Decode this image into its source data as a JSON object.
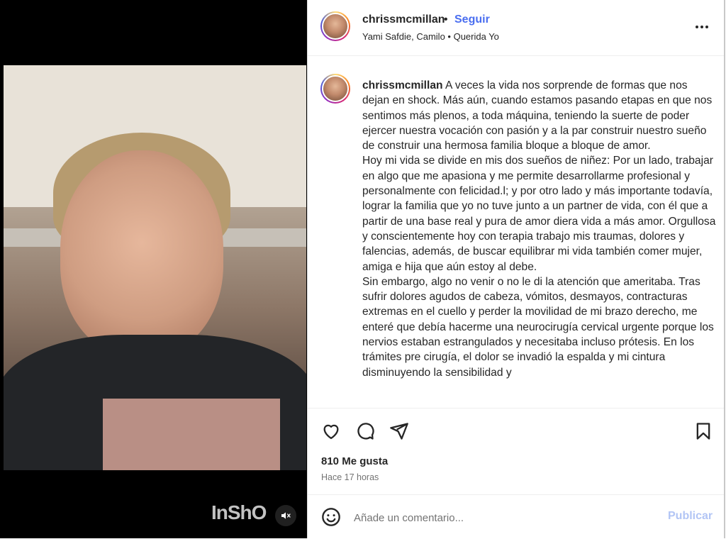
{
  "colors": {
    "follow_blue": "#4a6ef0",
    "publish_disabled": "#b2c5f5",
    "text_primary": "#262626",
    "text_secondary": "#737373"
  },
  "media": {
    "watermark": "InShO",
    "mute_icon": "speaker-muted-icon"
  },
  "header": {
    "username": "chrissmcmillan",
    "separator": "•",
    "follow_label": "Seguir",
    "audio_text": "Yami Safdie, Camilo • Querida Yo",
    "more_icon": "more-horizontal-icon"
  },
  "caption": {
    "username": "chrissmcmillan",
    "text": " A veces la vida nos sorprende de formas que nos dejan en shock. Más aún, cuando estamos pasando etapas en que nos sentimos más plenos, a toda máquina, teniendo la suerte de poder ejercer nuestra vocación con pasión y a la par construir nuestro sueño de construir una hermosa familia bloque a bloque de amor.\nHoy mi vida se divide en mis dos sueños de niñez: Por un lado, trabajar en algo que me apasiona y me permite desarrollarme profesional y personalmente con felicidad.l; y por otro lado y más importante todavía, lograr la familia que yo no tuve junto a un partner de vida, con él que a partir de una base real y pura de amor diera vida a más amor. Orgullosa y conscientemente hoy con terapia trabajo mis traumas, dolores y falencias, además, de buscar equilibrar mi vida también comer mujer, amiga e hija que aún estoy al debe.\nSin embargo, algo no venir o no le di la atención que ameritaba. Tras sufrir dolores agudos de cabeza, vómitos, desmayos, contracturas extremas en el cuello y perder la movilidad de mi brazo derecho, me enteré que debía hacerme una neurocirugía cervical urgente porque los nervios estaban estrangulados y necesitaba incluso prótesis. En los trámites pre cirugía, el dolor se invadió la espalda y mi cintura disminuyendo la sensibilidad y"
  },
  "actions": {
    "like_icon": "heart-icon",
    "comment_icon": "comment-icon",
    "share_icon": "share-icon",
    "save_icon": "bookmark-icon",
    "likes_text": "810 Me gusta",
    "time_text": "Hace 17 horas"
  },
  "comment_box": {
    "emoji_icon": "emoji-icon",
    "placeholder": "Añade un comentario...",
    "publish_label": "Publicar"
  }
}
